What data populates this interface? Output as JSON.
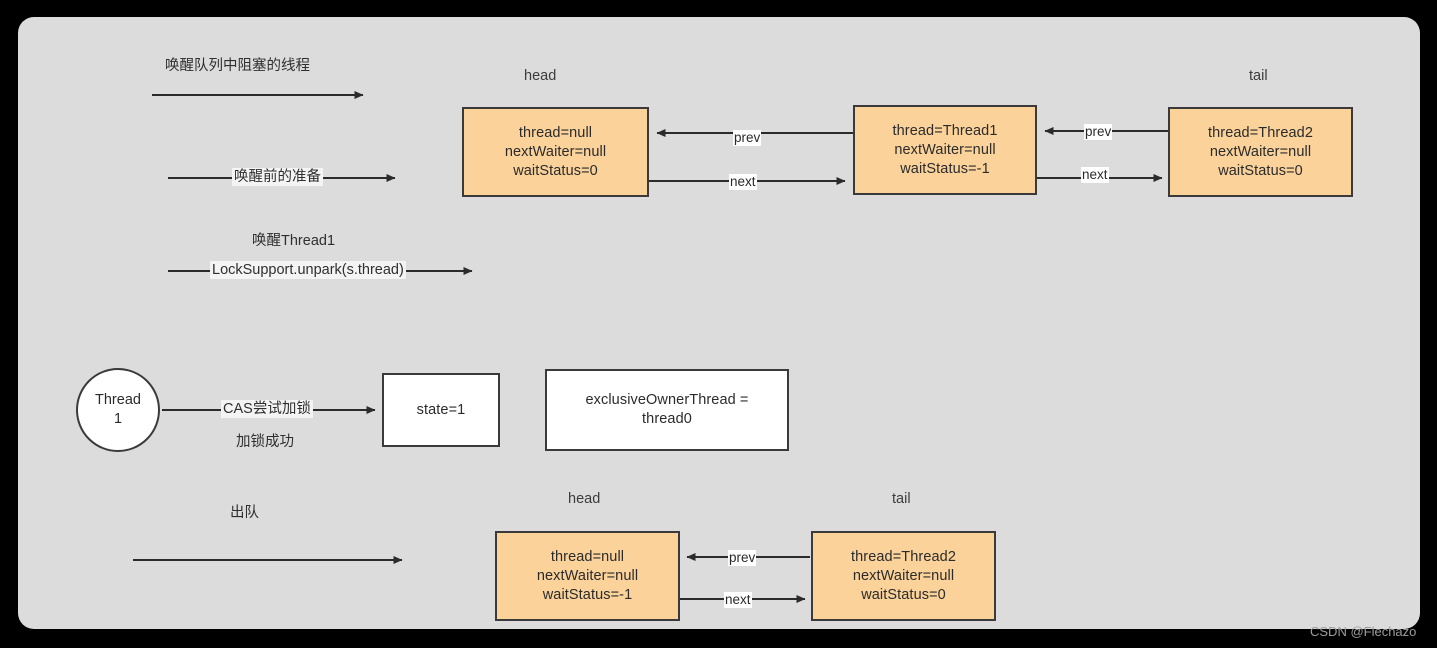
{
  "watermark": "CSDN @Flechazo",
  "top_section": {
    "flow_labels": [
      {
        "text": "唤醒队列中阻塞的线程"
      },
      {
        "text": "唤醒Thread1"
      }
    ],
    "line_labels": [
      {
        "text": "唤醒前的准备"
      },
      {
        "text": "LockSupport.unpark(s.thread)"
      }
    ],
    "captions": [
      {
        "text": "head"
      },
      {
        "text": "tail"
      }
    ],
    "nodes": [
      {
        "id": "head-node",
        "line1": "thread=null",
        "line2": "nextWaiter=null",
        "line3": "waitStatus=0"
      },
      {
        "id": "thread1-node",
        "line1": "thread=Thread1",
        "line2": "nextWaiter=null",
        "line3": "waitStatus=-1"
      },
      {
        "id": "thread2-node",
        "line1": "thread=Thread2",
        "line2": "nextWaiter=null",
        "line3": "waitStatus=0"
      }
    ],
    "edge_labels": [
      {
        "text": "prev"
      },
      {
        "text": "next"
      },
      {
        "text": "prev"
      },
      {
        "text": "next"
      }
    ]
  },
  "middle_section": {
    "circle": {
      "line1": "Thread",
      "line2": "1"
    },
    "line_label": "CAS尝试加锁",
    "sub_label": "加锁成功",
    "state_box": "state=1",
    "owner_box": {
      "line1": "exclusiveOwnerThread =",
      "line2": "thread0"
    }
  },
  "bottom_section": {
    "flow_label": "出队",
    "captions": [
      {
        "text": "head"
      },
      {
        "text": "tail"
      }
    ],
    "nodes": [
      {
        "id": "bottom-head-node",
        "line1": "thread=null",
        "line2": "nextWaiter=null",
        "line3": "waitStatus=-1"
      },
      {
        "id": "bottom-tail-node",
        "line1": "thread=Thread2",
        "line2": "nextWaiter=null",
        "line3": "waitStatus=0"
      }
    ],
    "edge_labels": [
      {
        "text": "prev"
      },
      {
        "text": "next"
      }
    ]
  },
  "colors": {
    "canvas_bg": "#dcdcdc",
    "node_fill": "#fad29a",
    "node_border": "#3a3a3a",
    "white_fill": "#ffffff",
    "arrow": "#2b2b2b"
  }
}
